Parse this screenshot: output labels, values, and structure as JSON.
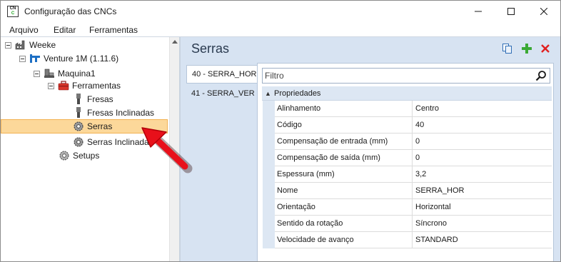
{
  "window": {
    "title": "Configuração das CNCs",
    "app_icon_text_top": "CN",
    "app_icon_text_bottom": "C"
  },
  "menu": {
    "arquivo": "Arquivo",
    "editar": "Editar",
    "ferramentas": "Ferramentas"
  },
  "tree": {
    "weeke": "Weeke",
    "venture": "Venture 1M (1.11.6)",
    "maquina": "Maquina1",
    "ferramentas": "Ferramentas",
    "fresas": "Fresas",
    "fresas_inclinadas": "Fresas Inclinadas",
    "serras": "Serras",
    "serras_inclinadas": "Serras Inclinadas",
    "setups": "Setups",
    "selected": "Serras"
  },
  "panel": {
    "title": "Serras",
    "tabs": [
      {
        "label": "40 - SERRA_HOR",
        "active": true
      },
      {
        "label": "41 - SERRA_VER",
        "active": false
      }
    ],
    "filter_placeholder": "Filtro",
    "category": {
      "toggle": "▲",
      "label": "Propriedades"
    },
    "properties": [
      {
        "name": "Alinhamento",
        "value": "Centro"
      },
      {
        "name": "Código",
        "value": "40"
      },
      {
        "name": "Compensação de entrada (mm)",
        "value": "0"
      },
      {
        "name": "Compensação de saída (mm)",
        "value": "0"
      },
      {
        "name": "Espessura (mm)",
        "value": "3,2"
      },
      {
        "name": "Nome",
        "value": "SERRA_HOR"
      },
      {
        "name": "Orientação",
        "value": "Horizontal"
      },
      {
        "name": "Sentido da rotação",
        "value": "Síncrono"
      },
      {
        "name": "Velocidade de avanço",
        "value": "STANDARD"
      }
    ]
  },
  "colors": {
    "selection_bg": "#fcd89a",
    "panel_bg": "#d7e3f2",
    "annotation_arrow": "#e8101a",
    "add_icon": "#3aa935",
    "delete_icon": "#e02020"
  },
  "icons": {
    "minimize": "minimize-icon",
    "maximize": "maximize-icon",
    "close": "close-icon",
    "copy": "copy-icon",
    "add": "plus-icon",
    "delete": "delete-x-icon",
    "search": "search-icon",
    "gear": "gear-icon",
    "toolbox": "toolbox-icon",
    "machine": "machine-icon",
    "factory": "factory-icon",
    "router_bit": "router-bit-icon",
    "annotation_arrow": "red-arrow-icon"
  }
}
